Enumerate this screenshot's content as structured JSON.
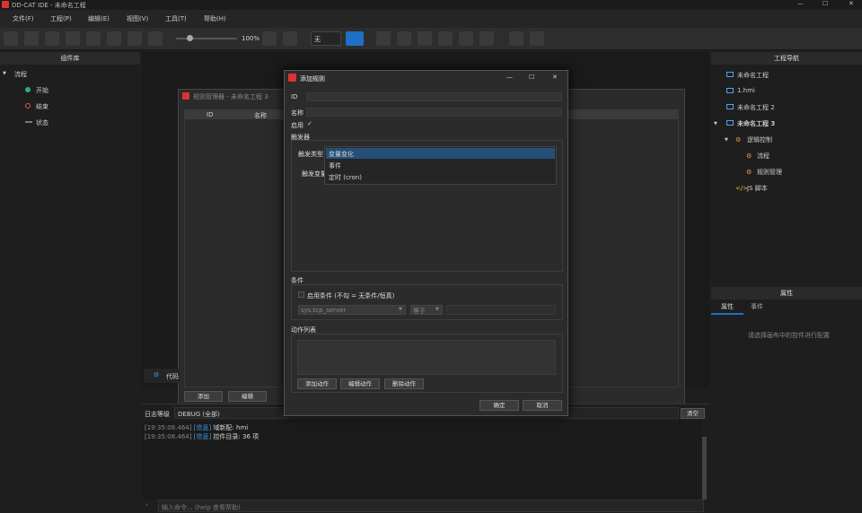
{
  "app": {
    "title": "DD-CAT IDE - 未命名工程",
    "win_min": "—",
    "win_max": "☐",
    "win_close": "✕"
  },
  "menu": [
    "文件(F)",
    "工程(P)",
    "编辑(E)",
    "视图(V)",
    "工具(T)",
    "帮助(H)"
  ],
  "toolbar": {
    "zoom": "100%",
    "combo_value": "无"
  },
  "left_panel": {
    "title": "组件库",
    "tree": {
      "root": "流程",
      "items": [
        "开始",
        "结束",
        "状态"
      ]
    }
  },
  "right_panel": {
    "title": "工程导航",
    "tree": [
      "未命名工程",
      "1.hmi",
      "未命名工程 2",
      "未命名工程 3",
      "逻辑控制",
      "流程",
      "规则管理",
      "JS 脚本"
    ],
    "props_title": "属性",
    "tabs": [
      "属性",
      "事件"
    ],
    "hint": "请选择画布中的控件进行配置"
  },
  "rule_manager": {
    "title": "规则管理器 - 未命名工程 3",
    "columns": [
      "ID",
      "名称"
    ],
    "buttons": [
      "添加",
      "编辑"
    ]
  },
  "code_tab": "代码",
  "log": {
    "level_label": "日志等级",
    "level_value": "DEBUG (全部)",
    "clear": "清空",
    "lines": [
      {
        "time": "[19:35:08.464]",
        "tag": "[信息]",
        "text": "域新配: hmi"
      },
      {
        "time": "[19:35:08.464]",
        "tag": "[信息]",
        "text": "控件目录: 36 项"
      }
    ],
    "command_placeholder": "输入命令... (help 查看帮助)"
  },
  "dialog": {
    "title": "添加规则",
    "id_label": "ID",
    "name_label": "名称",
    "enable_label": "启用",
    "enable_check": "✓",
    "trigger_group": "触发器",
    "trigger_type_label": "触发类型",
    "trigger_var_label": "触发变量",
    "trigger_options": [
      "变量变化",
      "事件",
      "定时 (cron)"
    ],
    "selected_trigger": "变量变化",
    "condition_group": "条件",
    "condition_enable": "启用条件 (不勾 = 无条件/恒真)",
    "condition_var": "sys.tcp_server",
    "condition_op": "等于",
    "action_group": "动作列表",
    "action_buttons": [
      "添加动作",
      "编辑动作",
      "删除动作"
    ],
    "ok": "确定",
    "cancel": "取消"
  },
  "colors": {
    "accent": "#1e6fc8",
    "selection": "#264f78",
    "info": "#3c9be8",
    "bg": "#1e1e1e"
  }
}
